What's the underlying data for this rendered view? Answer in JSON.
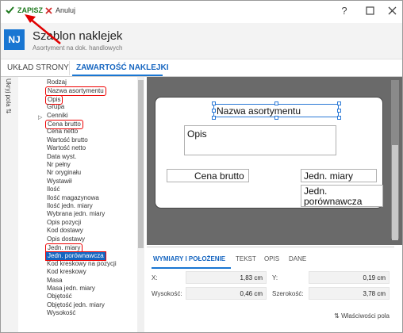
{
  "toolbar": {
    "save_label": "ZAPISZ",
    "cancel_label": "Anuluj",
    "help_label": "?"
  },
  "header": {
    "initials": "NJ",
    "title": "Szablon naklejek",
    "subtitle": "Asortyment na dok. handlowych"
  },
  "tabs": [
    "UKŁAD STRONY",
    "ZAWARTOŚĆ NAKLEJKI"
  ],
  "rail": {
    "label": "Ukryj pola ⇅"
  },
  "field_list": [
    "Rodzaj",
    "Nazwa asortymentu",
    "Opis",
    "Grupa",
    "Cenniki",
    "Cena brutto",
    "Cena netto",
    "Wartość brutto",
    "Wartość netto",
    "Data wyst.",
    "Nr pełny",
    "Nr oryginału",
    "Wystawił",
    "Ilość",
    "Ilość magazynowa",
    "Ilość jedn. miary",
    "Wybrana jedn. miary",
    "Opis pozycji",
    "Kod dostawy",
    "Opis dostawy",
    "Jedn. miary",
    "Jedn. porównawcza",
    "Kod kreskowy na pozycji",
    "Kod kreskowy",
    "Masa",
    "Masa jedn. miary",
    "Objętość",
    "Objętość jedn. miary",
    "Wysokość"
  ],
  "label_fields": {
    "nazwa": "Nazwa asortymentu",
    "opis": "Opis",
    "cena": "Cena brutto",
    "jedn": "Jedn. miary",
    "jedn_por": "Jedn. porównawcza"
  },
  "props": {
    "tabs": [
      "WYMIARY I POŁOŻENIE",
      "TEKST",
      "OPIS",
      "DANE"
    ],
    "x_label": "X:",
    "x_value": "1,83 cm",
    "y_label": "Y:",
    "y_value": "0,19 cm",
    "h_label": "Wysokość:",
    "h_value": "0,46 cm",
    "w_label": "Szerokość:",
    "w_value": "3,78 cm",
    "footer": "⇅ Właściwości pola"
  },
  "colors": {
    "accent": "#1976d2",
    "save": "#1f7a1f",
    "cancel": "#d32f2f",
    "highlight": "#e00000"
  }
}
